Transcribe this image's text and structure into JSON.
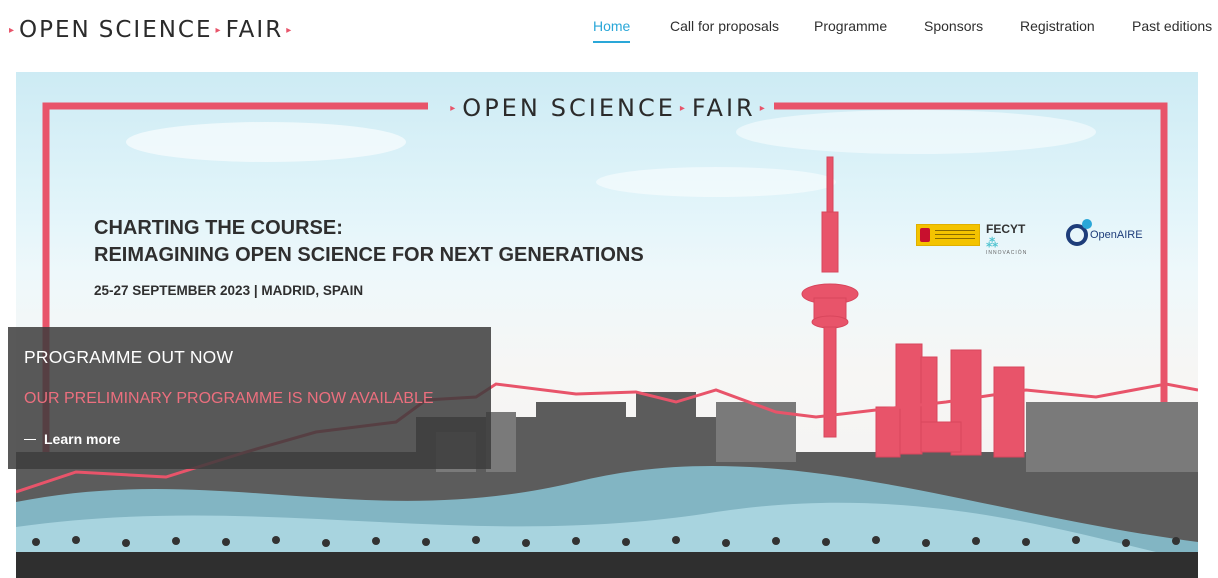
{
  "header": {
    "logo": {
      "left": "OPEN",
      "middle": "SCIENCE",
      "right": "FAIR"
    },
    "nav": [
      {
        "label": "Home",
        "active": true
      },
      {
        "label": "Call for proposals",
        "active": false
      },
      {
        "label": "Programme",
        "active": false
      },
      {
        "label": "Sponsors",
        "active": false
      },
      {
        "label": "Registration",
        "active": false
      },
      {
        "label": "Past editions",
        "active": false
      }
    ]
  },
  "hero": {
    "frame_title": {
      "left": "OPEN",
      "middle": "SCIENCE",
      "right": "FAIR"
    },
    "headline_line1": "CHARTING THE COURSE:",
    "headline_line2": "REIMAGINING OPEN SCIENCE FOR NEXT GENERATIONS",
    "dates": "25-27 SEPTEMBER 2023 | MADRID, SPAIN",
    "sponsors": {
      "fecyt": "FECYT",
      "fecyt_sub": "INNOVACIÓN",
      "openaire": "OpenAIRE"
    }
  },
  "promo": {
    "title": "PROGRAMME OUT NOW",
    "subtitle": "OUR PRELIMINARY PROGRAMME IS NOW AVAILABLE",
    "link": "Learn more"
  },
  "colors": {
    "accent": "#e8546a",
    "nav_active": "#2aa7d8",
    "overlay": "#3c3c3c"
  }
}
